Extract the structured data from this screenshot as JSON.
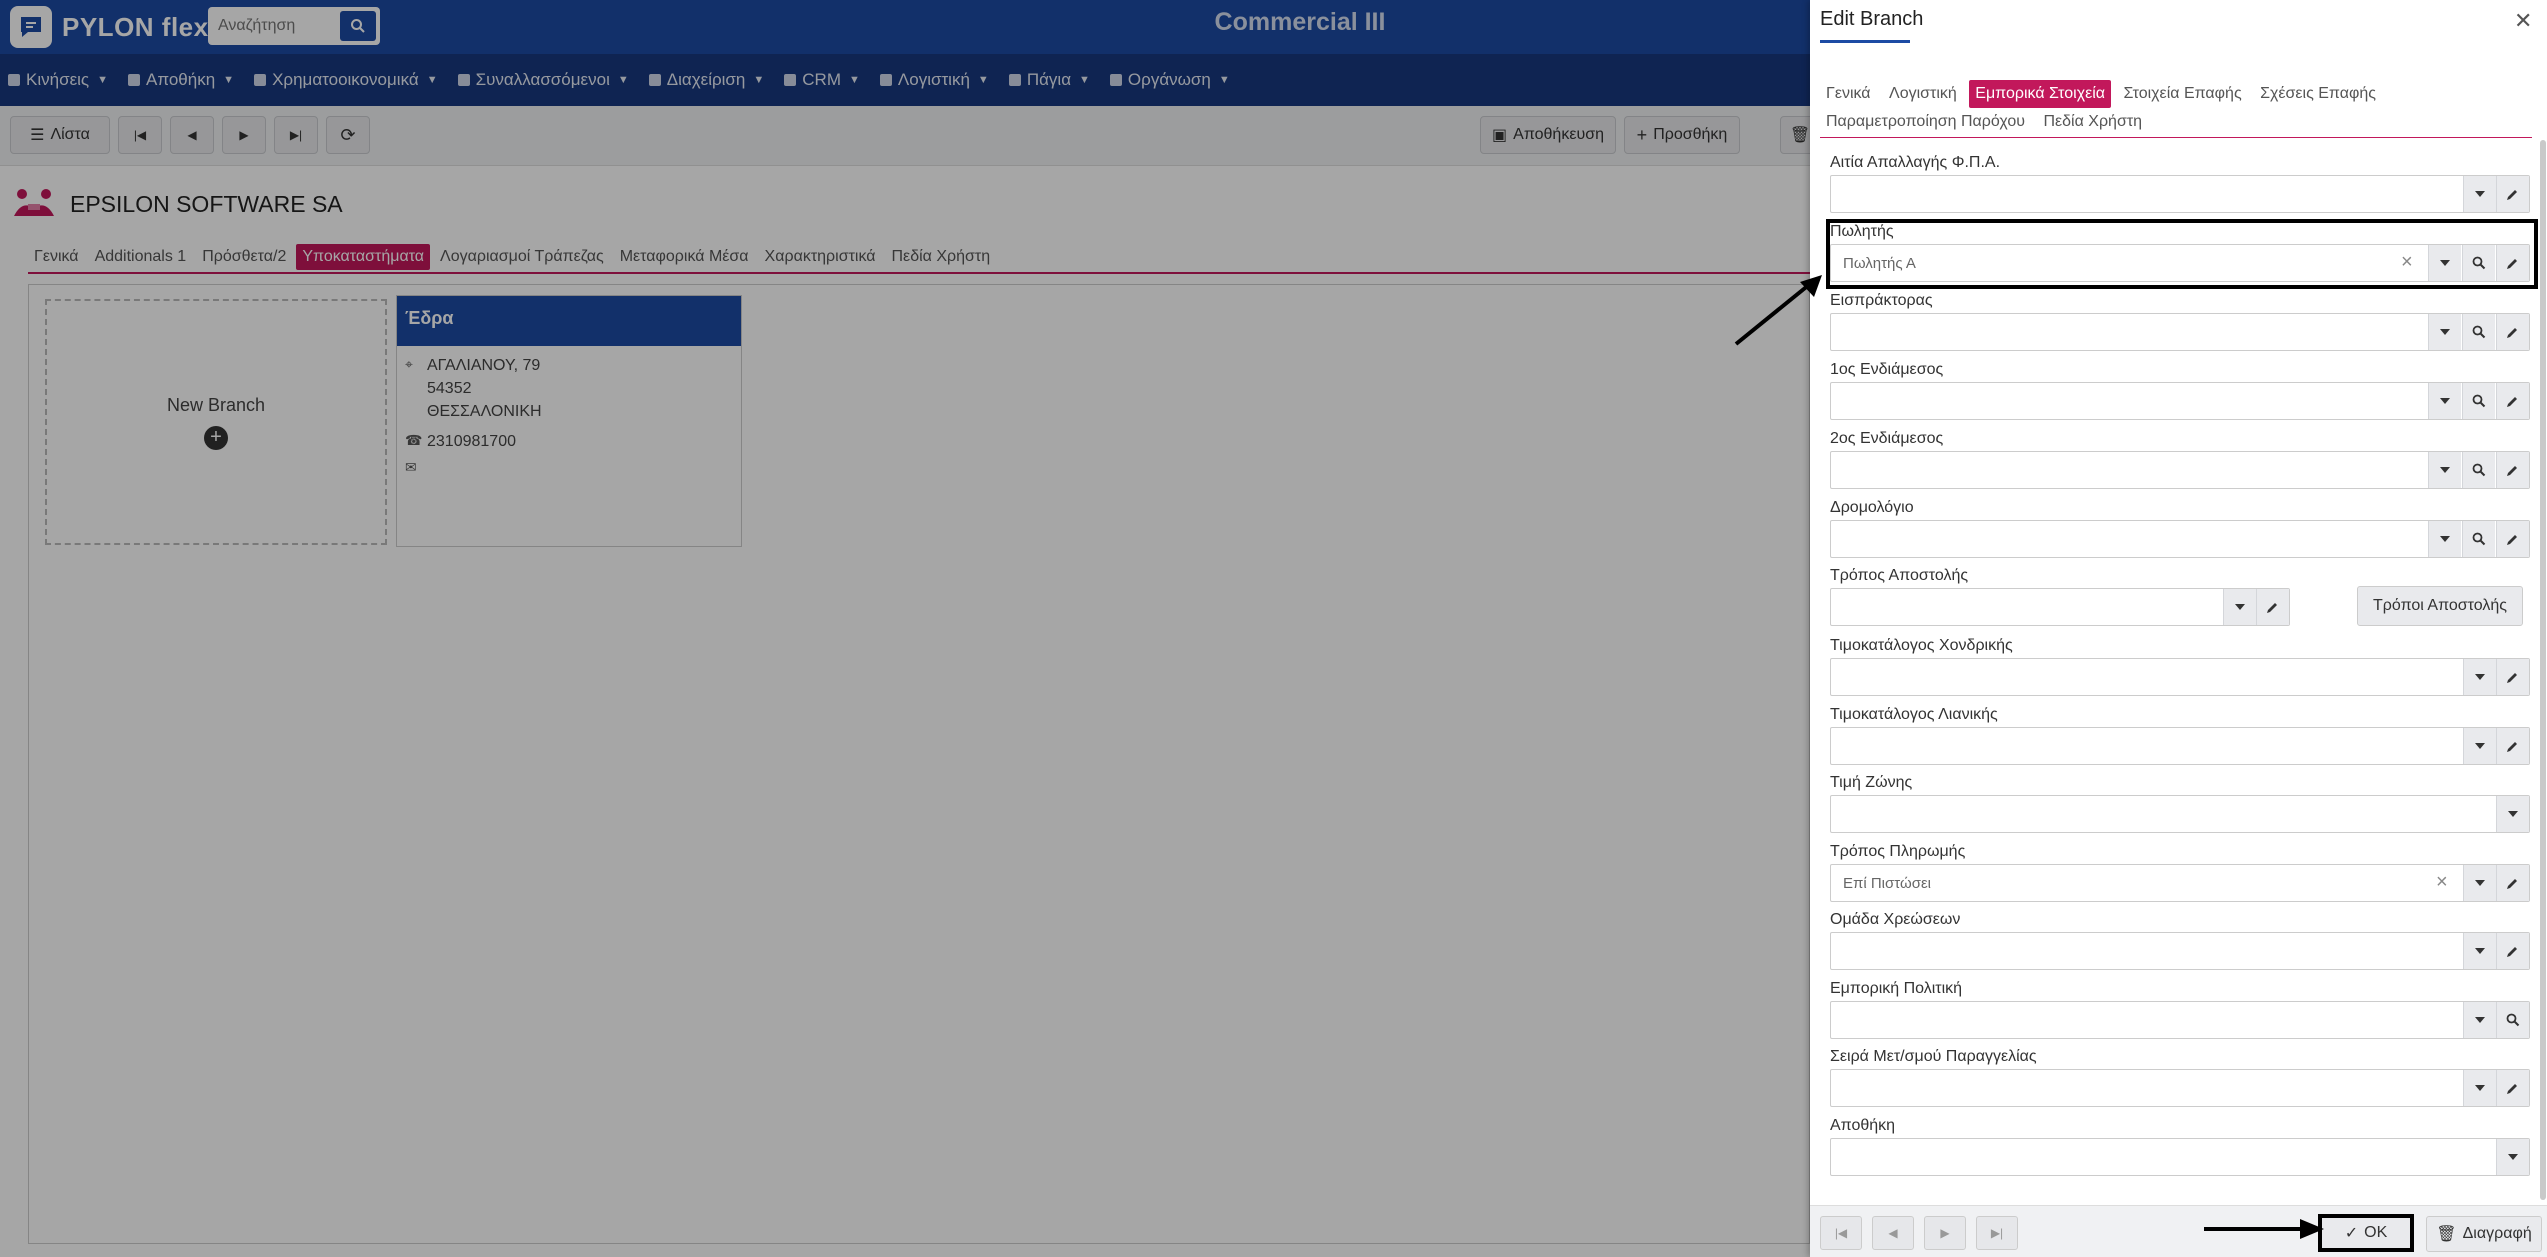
{
  "app": {
    "logo_text": "PYLON flex",
    "title": "Commercial III",
    "search_placeholder": "Αναζήτηση"
  },
  "nav": [
    {
      "label": "Κινήσεις"
    },
    {
      "label": "Αποθήκη"
    },
    {
      "label": "Χρηματοοικονομικά"
    },
    {
      "label": "Συναλλασσόμενοι"
    },
    {
      "label": "Διαχείριση"
    },
    {
      "label": "CRM"
    },
    {
      "label": "Λογιστική"
    },
    {
      "label": "Πάγια"
    },
    {
      "label": "Οργάνωση"
    }
  ],
  "toolbar": {
    "list": "Λίστα",
    "save": "Αποθήκευση",
    "add": "Προσθήκη"
  },
  "company": {
    "name": "EPSILON SOFTWARE SA"
  },
  "main_tabs": [
    "Γενικά",
    "Additionals 1",
    "Πρόσθετα/2",
    "Υποκαταστήματα",
    "Λογαριασμοί Τράπεζας",
    "Μεταφορικά Μέσα",
    "Χαρακτηριστικά",
    "Πεδία Χρήστη"
  ],
  "new_branch": {
    "label": "New Branch"
  },
  "branch": {
    "title": "Έδρα",
    "street": "ΑΓΑΛΙΑΝΟΥ, 79",
    "zip": "54352",
    "city": "ΘΕΣΣΑΛΟΝΙΚΗ",
    "phone": "2310981700"
  },
  "panel": {
    "title": "Edit Branch",
    "tabs": [
      "Γενικά",
      "Λογιστική",
      "Εμπορικά Στοιχεία",
      "Στοιχεία Επαφής",
      "Σχέσεις Επαφής",
      "Παραμετροποίηση Παρόχου",
      "Πεδία Χρήστη"
    ],
    "fields": [
      {
        "label": "Αιτία Απαλλαγής Φ.Π.Α.",
        "value": ""
      },
      {
        "label": "Πωλητής",
        "value": "Πωλητής Α"
      },
      {
        "label": "Εισπράκτορας",
        "value": ""
      },
      {
        "label": "1ος Ενδιάμεσος",
        "value": ""
      },
      {
        "label": "2ος Ενδιάμεσος",
        "value": ""
      },
      {
        "label": "Δρομολόγιο",
        "value": ""
      },
      {
        "label": "Τρόπος Αποστολής",
        "value": ""
      },
      {
        "label": "Τιμοκατάλογος Χονδρικής",
        "value": ""
      },
      {
        "label": "Τιμοκατάλογος Λιανικής",
        "value": ""
      },
      {
        "label": "Τιμή Ζώνης",
        "value": ""
      },
      {
        "label": "Τρόπος Πληρωμής",
        "value": "Επί Πιστώσει"
      },
      {
        "label": "Ομάδα Χρεώσεων",
        "value": ""
      },
      {
        "label": "Εμπορική Πολιτική",
        "value": ""
      },
      {
        "label": "Σειρά Μετ/σμού Παραγγελίας",
        "value": ""
      },
      {
        "label": "Αποθήκη",
        "value": ""
      }
    ],
    "shipping_methods_button": "Τρόποι Αποστολής",
    "ok": "OK",
    "delete": "Διαγραφή"
  }
}
